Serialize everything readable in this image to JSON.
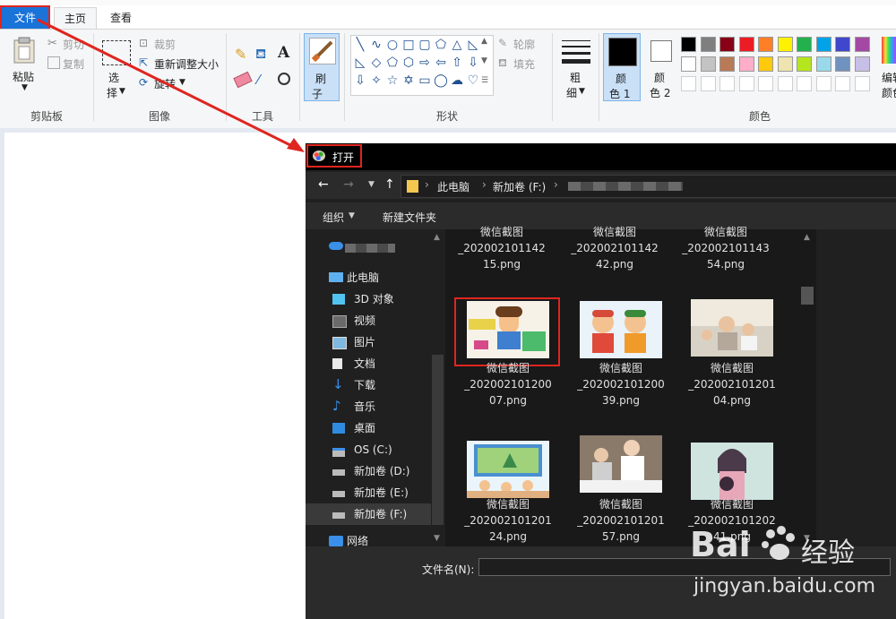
{
  "ribbon": {
    "tabs": [
      "文件",
      "主页",
      "查看"
    ],
    "clipboard": {
      "paste": "粘贴",
      "cut": "剪切",
      "copy": "复制",
      "group": "剪贴板"
    },
    "image": {
      "select_1": "选",
      "select_2": "择",
      "crop": "裁剪",
      "resize": "重新调整大小",
      "rotate": "旋转",
      "group": "图像"
    },
    "tools": {
      "text_glyph": "A",
      "group": "工具"
    },
    "brush": {
      "line1": "刷",
      "line2": "子"
    },
    "shapes": {
      "outline": "轮廓",
      "fill": "填充",
      "group": "形状"
    },
    "size": {
      "line1": "粗",
      "line2": "细"
    },
    "colors": {
      "color1_a": "颜",
      "color1_b": "色 1",
      "color2_a": "颜",
      "color2_b": "色 2",
      "edit_a": "编辑",
      "edit_b": "颜色",
      "group": "颜色",
      "palette_row1": [
        "#000000",
        "#7f7f7f",
        "#880015",
        "#ed1c24",
        "#ff7f27",
        "#fff200",
        "#22b14c",
        "#00a2e8",
        "#3f48cc",
        "#a349a4"
      ],
      "palette_row2": [
        "#ffffff",
        "#c3c3c3",
        "#b97a57",
        "#ffaec9",
        "#ffc90e",
        "#efe4b0",
        "#b5e61d",
        "#99d9ea",
        "#7092be",
        "#c8bfe7"
      ]
    }
  },
  "dialog": {
    "title": "打开",
    "breadcrumb": [
      "此电脑",
      "新加卷 (F:)"
    ],
    "toolbar": {
      "organize": "组织",
      "new_folder": "新建文件夹"
    },
    "nav": [
      "此电脑",
      "3D 对象",
      "视频",
      "图片",
      "文档",
      "下载",
      "音乐",
      "桌面",
      "OS (C:)",
      "新加卷 (D:)",
      "新加卷 (E:)",
      "新加卷 (F:)",
      "网络"
    ],
    "files_top": [
      {
        "line1": "_202002101142",
        "line2": "15.png"
      },
      {
        "line1": "_202002101142",
        "line2": "42.png"
      },
      {
        "line1": "_202002101143",
        "line2": "54.png"
      }
    ],
    "files_top_partial": [
      "微信截图",
      "微信截图",
      "微信截图"
    ],
    "files": [
      {
        "line0": "微信截图",
        "line1": "_202002101200",
        "line2": "07.png"
      },
      {
        "line0": "微信截图",
        "line1": "_202002101200",
        "line2": "39.png"
      },
      {
        "line0": "微信截图",
        "line1": "_202002101201",
        "line2": "04.png"
      },
      {
        "line0": "微信截图",
        "line1": "_202002101201",
        "line2": "24.png"
      },
      {
        "line0": "微信截图",
        "line1": "_202002101201",
        "line2": "57.png"
      },
      {
        "line0": "微信截图",
        "line1": "_202002101202",
        "line2": "41.png"
      }
    ],
    "filename_label": "文件名(N):",
    "filename_value": ""
  },
  "watermark": {
    "brand": "Bai",
    "brand2": "经验",
    "url": "jingyan.baidu.com"
  },
  "icons": {
    "paste": "clipboard-icon",
    "cut": "scissors-icon",
    "copy": "copy-icon",
    "select": "select-icon",
    "crop": "crop-icon",
    "resize": "resize-icon",
    "rotate": "rotate-icon",
    "pencil": "pencil-icon",
    "fill": "bucket-icon",
    "text": "text-icon",
    "eraser": "eraser-icon",
    "picker": "color-picker-icon",
    "magnifier": "magnifier-icon",
    "brush": "brush-icon",
    "size": "line-size-icon"
  }
}
